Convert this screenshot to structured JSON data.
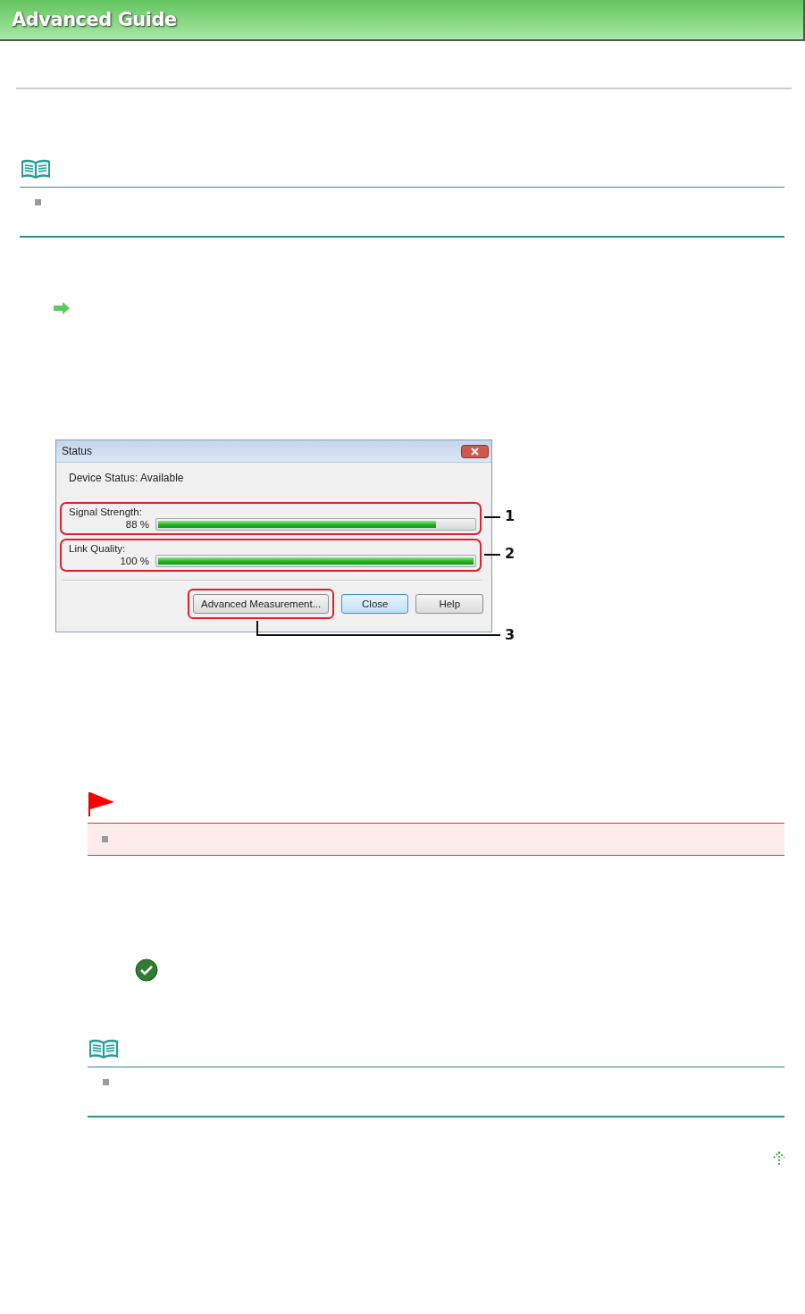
{
  "header": {
    "title": "Advanced Guide"
  },
  "dialog": {
    "title": "Status",
    "device_status": "Device Status: Available",
    "meters": [
      {
        "label": "Signal Strength:",
        "reading": "88 %",
        "level": 0.88,
        "callout": "1"
      },
      {
        "label": "Link Quality:",
        "reading": "100 %",
        "level": 1,
        "callout": "2"
      }
    ],
    "buttons": [
      {
        "label": "Advanced Measurement...",
        "callout": "3",
        "focused": false
      },
      {
        "label": "Close",
        "focused": true
      },
      {
        "label": "Help",
        "focused": false
      }
    ]
  }
}
